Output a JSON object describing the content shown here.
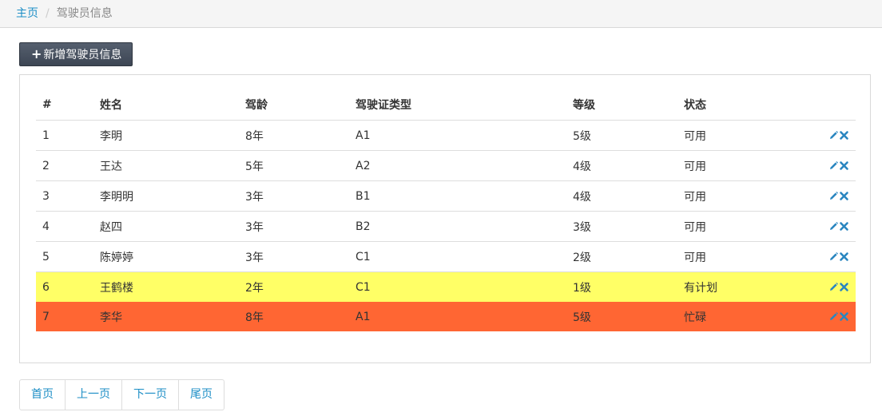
{
  "breadcrumb": {
    "home": "主页",
    "separator": "/",
    "current": "驾驶员信息"
  },
  "toolbar": {
    "add_label": "新增驾驶员信息",
    "add_icon": "plus-icon"
  },
  "table": {
    "headers": [
      "#",
      "姓名",
      "驾龄",
      "驾驶证类型",
      "等级",
      "状态",
      ""
    ],
    "rows": [
      {
        "id": "1",
        "name": "李明",
        "years": "8年",
        "license": "A1",
        "level": "5级",
        "status": "可用",
        "highlight": "none"
      },
      {
        "id": "2",
        "name": "王达",
        "years": "5年",
        "license": "A2",
        "level": "4级",
        "status": "可用",
        "highlight": "none"
      },
      {
        "id": "3",
        "name": "李明明",
        "years": "3年",
        "license": "B1",
        "level": "4级",
        "status": "可用",
        "highlight": "none"
      },
      {
        "id": "4",
        "name": "赵四",
        "years": "3年",
        "license": "B2",
        "level": "3级",
        "status": "可用",
        "highlight": "none"
      },
      {
        "id": "5",
        "name": "陈婷婷",
        "years": "3年",
        "license": "C1",
        "level": "2级",
        "status": "可用",
        "highlight": "none"
      },
      {
        "id": "6",
        "name": "王鹤楼",
        "years": "2年",
        "license": "C1",
        "level": "1级",
        "status": "有计划",
        "highlight": "warn"
      },
      {
        "id": "7",
        "name": "李华",
        "years": "8年",
        "license": "A1",
        "level": "5级",
        "status": "忙碌",
        "highlight": "busy"
      }
    ],
    "row_actions": [
      "pencil-icon",
      "close-icon"
    ]
  },
  "pager": {
    "first": "首页",
    "prev": "上一页",
    "next": "下一页",
    "last": "尾页"
  },
  "colors": {
    "link": "#1c8ec6",
    "warn_row": "#ffff66",
    "busy_row": "#ff6633",
    "button_bg": "#4a5361"
  }
}
